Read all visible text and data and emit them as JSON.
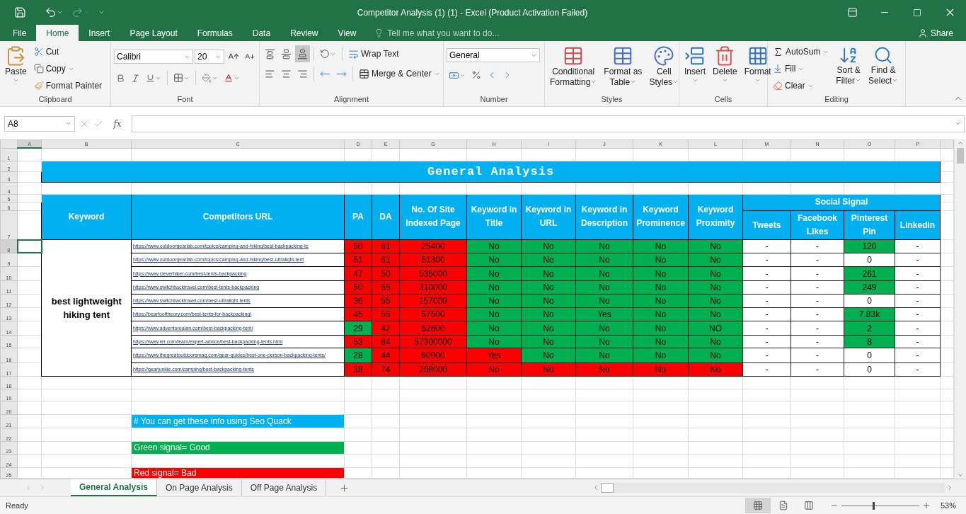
{
  "title_bar": {
    "title": "Competitor Analysis (1) (1) - Excel (Product Activation Failed)"
  },
  "ribbon_tabs": [
    {
      "label": "File",
      "selected": false
    },
    {
      "label": "Home",
      "selected": true
    },
    {
      "label": "Insert",
      "selected": false
    },
    {
      "label": "Page Layout",
      "selected": false
    },
    {
      "label": "Formulas",
      "selected": false
    },
    {
      "label": "Data",
      "selected": false
    },
    {
      "label": "Review",
      "selected": false
    },
    {
      "label": "View",
      "selected": false
    }
  ],
  "tell_me": {
    "placeholder": "Tell me what you want to do..."
  },
  "share": "Share",
  "ribbon": {
    "clipboard": {
      "label": "Clipboard",
      "paste": "Paste",
      "cut": "Cut",
      "copy": "Copy",
      "format_painter": "Format Painter"
    },
    "font": {
      "label": "Font",
      "family": "Calibri",
      "size": "20"
    },
    "alignment": {
      "label": "Alignment",
      "vertical": [
        {
          "kind": "top",
          "selected": false
        },
        {
          "kind": "middle",
          "selected": false
        },
        {
          "kind": "bottom",
          "selected": true
        }
      ],
      "wrap_text": "Wrap Text",
      "merge_center": "Merge & Center"
    },
    "number": {
      "label": "Number",
      "format": "General"
    },
    "styles": {
      "label": "Styles",
      "buttons": [
        {
          "kind": "conditional",
          "lines": [
            "Conditional",
            "Formatting"
          ]
        },
        {
          "kind": "table",
          "lines": [
            "Format as",
            "Table"
          ]
        },
        {
          "kind": "cell",
          "lines": [
            "Cell",
            "Styles"
          ]
        }
      ]
    },
    "cells": {
      "label": "Cells",
      "buttons": [
        {
          "kind": "insert",
          "label": "Insert"
        },
        {
          "kind": "delete",
          "label": "Delete"
        },
        {
          "kind": "format",
          "label": "Format"
        }
      ]
    },
    "editing": {
      "label": "Editing",
      "autosum": "AutoSum",
      "fill": "Fill",
      "clear": "Clear",
      "buttons": [
        {
          "kind": "sort",
          "lines": [
            "Sort &",
            "Filter"
          ]
        },
        {
          "kind": "find",
          "lines": [
            "Find &",
            "Select"
          ]
        }
      ]
    }
  },
  "formula_bar": {
    "name_box": "A8",
    "fx": "fx"
  },
  "sheet": {
    "columns": [
      {
        "label": "A",
        "selected": true
      },
      {
        "label": "B",
        "selected": false
      },
      {
        "label": "C",
        "selected": false
      },
      {
        "label": "D",
        "selected": false
      },
      {
        "label": "E",
        "selected": false
      },
      {
        "label": "G",
        "selected": false
      },
      {
        "label": "H",
        "selected": false
      },
      {
        "label": "I",
        "selected": false
      },
      {
        "label": "J",
        "selected": false
      },
      {
        "label": "K",
        "selected": false
      },
      {
        "label": "L",
        "selected": false
      },
      {
        "label": "M",
        "selected": false
      },
      {
        "label": "N",
        "selected": false
      },
      {
        "label": "O",
        "selected": false
      },
      {
        "label": "P",
        "selected": false
      }
    ],
    "rows": [
      {
        "label": "1",
        "selected": false
      },
      {
        "label": "2",
        "selected": false
      },
      {
        "label": "3",
        "selected": false
      },
      {
        "label": "4",
        "selected": false
      },
      {
        "label": "5",
        "selected": false
      },
      {
        "label": "6",
        "selected": false
      },
      {
        "label": "7",
        "selected": false
      },
      {
        "label": "8",
        "selected": true
      },
      {
        "label": "9",
        "selected": false
      },
      {
        "label": "10",
        "selected": false
      },
      {
        "label": "11",
        "selected": false
      },
      {
        "label": "12",
        "selected": false
      },
      {
        "label": "13",
        "selected": false
      },
      {
        "label": "14",
        "selected": false
      },
      {
        "label": "15",
        "selected": false
      },
      {
        "label": "16",
        "selected": false
      },
      {
        "label": "17",
        "selected": false
      },
      {
        "label": "18",
        "selected": false
      },
      {
        "label": "19",
        "selected": false
      },
      {
        "label": "20",
        "selected": false
      },
      {
        "label": "21",
        "selected": false
      },
      {
        "label": "22",
        "selected": false
      },
      {
        "label": "23",
        "selected": false
      },
      {
        "label": "24",
        "selected": false
      },
      {
        "label": "25",
        "selected": false
      }
    ],
    "title": "General Analysis",
    "headers": [
      "Keyword",
      "Competitors URL",
      "PA",
      "DA",
      "No. Of Site Indexed Page",
      "Keyword in Title",
      "Keyword in URL",
      "Keyword in Description",
      "Keyword Prominence",
      "Keyword Proximity"
    ],
    "social_signal": {
      "label": "Social Signal",
      "columns": [
        "Tweets",
        "Facebook Likes",
        "Pinterest Pin",
        "Linkedin"
      ]
    },
    "keyword": "best lightweight hiking tent",
    "data_rows": [
      {
        "url": "https://www.outdoorgearlab.com/topics/camping-and-hiking/best-backpacking-te",
        "cells": [
          {
            "value": "50",
            "color": "#ff0000"
          },
          {
            "value": "61",
            "color": "#ff0000"
          },
          {
            "value": "25400",
            "color": "#ff0000"
          },
          {
            "value": "No",
            "color": "#00b050"
          },
          {
            "value": "No",
            "color": "#00b050"
          },
          {
            "value": "No",
            "color": "#00b050"
          },
          {
            "value": "No",
            "color": "#00b050"
          },
          {
            "value": "No",
            "color": "#00b050"
          },
          {
            "value": "-"
          },
          {
            "value": "-"
          },
          {
            "value": "120",
            "color": "#00b050"
          },
          {
            "value": "-"
          }
        ]
      },
      {
        "url": "https://www.outdoorgearlab.com/topics/camping-and-hiking/best-ultralight-tent",
        "cells": [
          {
            "value": "51",
            "color": "#ff0000"
          },
          {
            "value": "61",
            "color": "#ff0000"
          },
          {
            "value": "51300",
            "color": "#ff0000"
          },
          {
            "value": "No",
            "color": "#00b050"
          },
          {
            "value": "No",
            "color": "#00b050"
          },
          {
            "value": "No",
            "color": "#00b050"
          },
          {
            "value": "No",
            "color": "#00b050"
          },
          {
            "value": "No",
            "color": "#00b050"
          },
          {
            "value": "-"
          },
          {
            "value": "-"
          },
          {
            "value": "0"
          },
          {
            "value": "-"
          }
        ]
      },
      {
        "url": "https://www.cleverhiker.com/best-tents-backpacking",
        "cells": [
          {
            "value": "47",
            "color": "#ff0000"
          },
          {
            "value": "50",
            "color": "#ff0000"
          },
          {
            "value": "535000",
            "color": "#ff0000"
          },
          {
            "value": "No",
            "color": "#00b050"
          },
          {
            "value": "No",
            "color": "#00b050"
          },
          {
            "value": "No",
            "color": "#00b050"
          },
          {
            "value": "No",
            "color": "#00b050"
          },
          {
            "value": "No",
            "color": "#00b050"
          },
          {
            "value": "-"
          },
          {
            "value": "-"
          },
          {
            "value": "261",
            "color": "#00b050"
          },
          {
            "value": "-"
          }
        ]
      },
      {
        "url": "https://www.switchbacktravel.com/best-tents-backpacking",
        "cells": [
          {
            "value": "50",
            "color": "#ff0000"
          },
          {
            "value": "55",
            "color": "#ff0000"
          },
          {
            "value": "310000",
            "color": "#ff0000"
          },
          {
            "value": "No",
            "color": "#00b050"
          },
          {
            "value": "No",
            "color": "#00b050"
          },
          {
            "value": "No",
            "color": "#00b050"
          },
          {
            "value": "No",
            "color": "#00b050"
          },
          {
            "value": "No",
            "color": "#00b050"
          },
          {
            "value": "-"
          },
          {
            "value": "-"
          },
          {
            "value": "249",
            "color": "#00b050"
          },
          {
            "value": "-"
          }
        ]
      },
      {
        "url": "https://www.switchbacktravel.com/best-ultralight-tents",
        "cells": [
          {
            "value": "36",
            "color": "#ff0000"
          },
          {
            "value": "55",
            "color": "#ff0000"
          },
          {
            "value": "257000",
            "color": "#ff0000"
          },
          {
            "value": "No",
            "color": "#00b050"
          },
          {
            "value": "No",
            "color": "#00b050"
          },
          {
            "value": "No",
            "color": "#00b050"
          },
          {
            "value": "No",
            "color": "#00b050"
          },
          {
            "value": "No",
            "color": "#00b050"
          },
          {
            "value": "-"
          },
          {
            "value": "-"
          },
          {
            "value": "0"
          },
          {
            "value": "-"
          }
        ]
      },
      {
        "url": "https://bearfoottheory.com/best-tents-for-backpacking/",
        "cells": [
          {
            "value": "45",
            "color": "#ff0000"
          },
          {
            "value": "55",
            "color": "#ff0000"
          },
          {
            "value": "57500",
            "color": "#ff0000"
          },
          {
            "value": "No",
            "color": "#00b050"
          },
          {
            "value": "No",
            "color": "#00b050"
          },
          {
            "value": "Yes",
            "color": "#00b050"
          },
          {
            "value": "No",
            "color": "#00b050"
          },
          {
            "value": "No",
            "color": "#00b050"
          },
          {
            "value": "-"
          },
          {
            "value": "-"
          },
          {
            "value": "7.83k",
            "color": "#00b050"
          },
          {
            "value": "-"
          }
        ]
      },
      {
        "url": "https://www.adventurealan.com/best-backpacking-tent/",
        "cells": [
          {
            "value": "29",
            "color": "#00b050"
          },
          {
            "value": "42",
            "color": "#ff0000"
          },
          {
            "value": "62600",
            "color": "#ff0000"
          },
          {
            "value": "No",
            "color": "#00b050"
          },
          {
            "value": "No",
            "color": "#00b050"
          },
          {
            "value": "No",
            "color": "#00b050"
          },
          {
            "value": "No",
            "color": "#00b050"
          },
          {
            "value": "NO",
            "color": "#00b050"
          },
          {
            "value": "-"
          },
          {
            "value": "-"
          },
          {
            "value": "2",
            "color": "#00b050"
          },
          {
            "value": "-"
          }
        ]
      },
      {
        "url": "https://www.rei.com/learn/expert-advice/best-backpacking-tents.html",
        "cells": [
          {
            "value": "53",
            "color": "#ff0000"
          },
          {
            "value": "84",
            "color": "#ff0000"
          },
          {
            "value": "57300000",
            "color": "#ff0000"
          },
          {
            "value": "No",
            "color": "#00b050"
          },
          {
            "value": "No",
            "color": "#00b050"
          },
          {
            "value": "No",
            "color": "#00b050"
          },
          {
            "value": "No",
            "color": "#00b050"
          },
          {
            "value": "No",
            "color": "#00b050"
          },
          {
            "value": "-"
          },
          {
            "value": "-"
          },
          {
            "value": "8",
            "color": "#00b050"
          },
          {
            "value": "-"
          }
        ]
      },
      {
        "url": "https://www.thegreatoutdoorsmag.com/gear-guides/best-one-person-backpacking-tents/",
        "cells": [
          {
            "value": "28",
            "color": "#00b050"
          },
          {
            "value": "44",
            "color": "#ff0000"
          },
          {
            "value": "60000",
            "color": "#ff0000"
          },
          {
            "value": "Yes",
            "color": "#ff0000"
          },
          {
            "value": "No",
            "color": "#00b050"
          },
          {
            "value": "No",
            "color": "#00b050"
          },
          {
            "value": "No",
            "color": "#00b050"
          },
          {
            "value": "No",
            "color": "#00b050"
          },
          {
            "value": "-"
          },
          {
            "value": "-"
          },
          {
            "value": "0"
          },
          {
            "value": "-"
          }
        ]
      },
      {
        "url": "https://gearjunkie.com/camping/best-backpacking-tents",
        "cells": [
          {
            "value": "38",
            "color": "#ff0000"
          },
          {
            "value": "74",
            "color": "#ff0000"
          },
          {
            "value": "298000",
            "color": "#ff0000"
          },
          {
            "value": "No",
            "color": "#ff0000"
          },
          {
            "value": "No",
            "color": "#ff0000"
          },
          {
            "value": "No",
            "color": "#ff0000"
          },
          {
            "value": "No",
            "color": "#ff0000"
          },
          {
            "value": "No",
            "color": "#ff0000"
          },
          {
            "value": "-"
          },
          {
            "value": "-"
          },
          {
            "value": "0"
          },
          {
            "value": "-"
          }
        ]
      }
    ],
    "notes": [
      {
        "text": "# You can get these info using Seo Quack",
        "color": "#00b0f0"
      },
      {
        "text": "Green signal= Good",
        "color": "#00b050"
      },
      {
        "text": "Red signal= Bad",
        "color": "#ff0000"
      }
    ]
  },
  "sheet_tabs": [
    {
      "label": "General Analysis",
      "selected": true
    },
    {
      "label": "On Page Analysis",
      "selected": false
    },
    {
      "label": "Off Page Analysis",
      "selected": false
    }
  ],
  "status_bar": {
    "status": "Ready",
    "zoom": {
      "reading": "53%",
      "level": 0.4
    }
  }
}
